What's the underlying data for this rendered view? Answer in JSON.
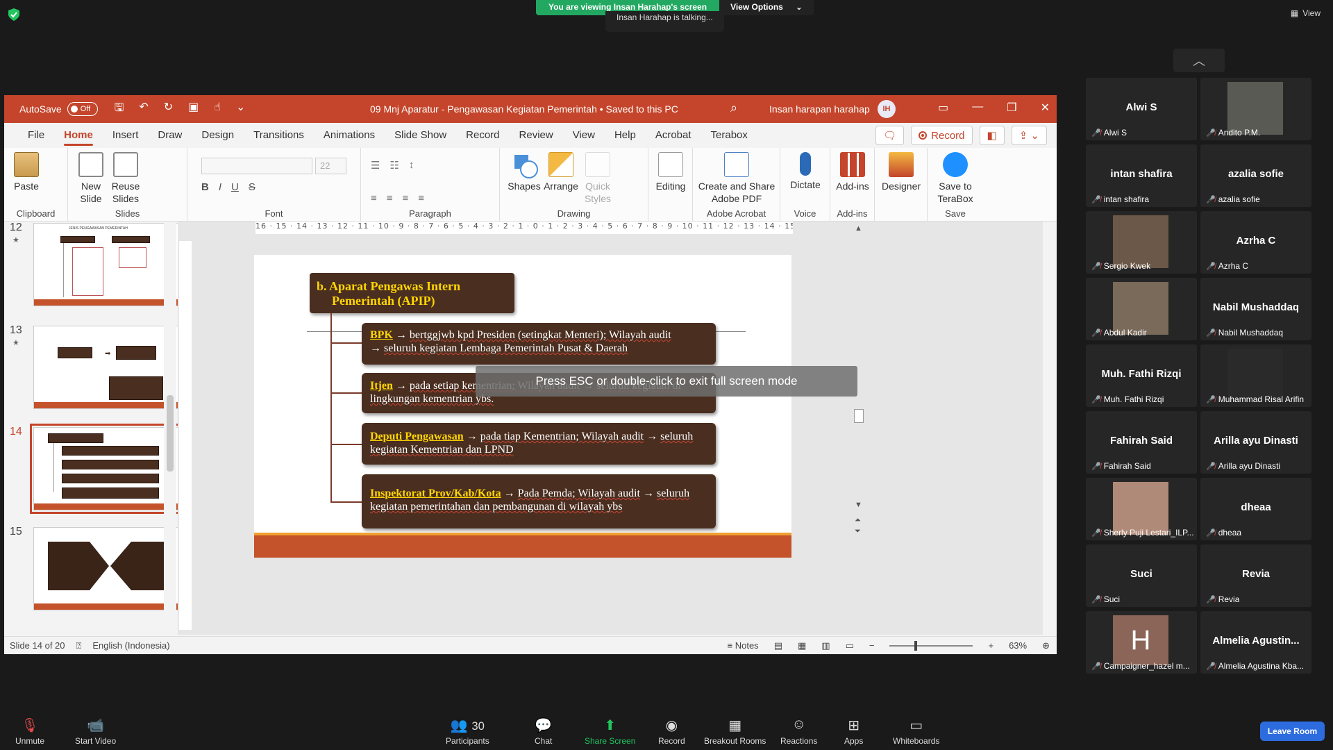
{
  "zoom": {
    "share_banner": "You are viewing Insan Harahap's screen",
    "view_options": "View Options",
    "talking": "Insan Harahap is talking...",
    "view_label": "View",
    "toolbar": {
      "unmute": "Unmute",
      "start_video": "Start Video",
      "participants": "Participants",
      "participants_count": "30",
      "chat": "Chat",
      "share_screen": "Share Screen",
      "record": "Record",
      "breakout": "Breakout Rooms",
      "reactions": "Reactions",
      "apps": "Apps",
      "whiteboards": "Whiteboards",
      "leave": "Leave Room"
    },
    "participants": [
      {
        "display": "Alwi S",
        "label": "Alwi S",
        "video": false
      },
      {
        "display": "",
        "label": "Andito P.M.",
        "video": true
      },
      {
        "display": "intan shafira",
        "label": "intan shafira",
        "video": false
      },
      {
        "display": "azalia sofie",
        "label": "azalia sofie",
        "video": false
      },
      {
        "display": "",
        "label": "Sergio Kwek",
        "video": true
      },
      {
        "display": "Azrha C",
        "label": "Azrha C",
        "video": false
      },
      {
        "display": "",
        "label": "Abdul Kadir",
        "video": true
      },
      {
        "display": "Nabil Mushaddaq",
        "label": "Nabil Mushaddaq",
        "video": false
      },
      {
        "display": "Muh. Fathi Rizqi",
        "label": "Muh. Fathi Rizqi",
        "video": false
      },
      {
        "display": "",
        "label": "Muhammad Risal Arifin",
        "video": true
      },
      {
        "display": "Fahirah Said",
        "label": "Fahirah Said",
        "video": false
      },
      {
        "display": "Arilla ayu Dinasti",
        "label": "Arilla ayu Dinasti",
        "video": false
      },
      {
        "display": "",
        "label": "Sherly Puji Lestari_ILP...",
        "video": true
      },
      {
        "display": "dheaa",
        "label": "dheaa",
        "video": false
      },
      {
        "display": "Suci",
        "label": "Suci",
        "video": false
      },
      {
        "display": "Revia",
        "label": "Revia",
        "video": false
      },
      {
        "display": "H",
        "label": "Campaigner_hazel m...",
        "video": false
      },
      {
        "display": "Almelia  Agustin...",
        "label": "Almelia Agustina Kba...",
        "video": false
      }
    ]
  },
  "ppt": {
    "autosave": "AutoSave",
    "autosave_state": "Off",
    "doc_title": "09  Mnj Aparatur - Pengawasan Kegiatan Pemerintah • Saved to this PC",
    "user_name": "Insan harapan harahap",
    "user_initials": "IH",
    "tabs": [
      "File",
      "Home",
      "Insert",
      "Draw",
      "Design",
      "Transitions",
      "Animations",
      "Slide Show",
      "Record",
      "Review",
      "View",
      "Help",
      "Acrobat",
      "Terabox"
    ],
    "active_tab": "Home",
    "record_button": "Record",
    "ribbon": {
      "paste": "Paste",
      "new_slide": "New Slide",
      "reuse_slides": "Reuse Slides",
      "font_size": "22",
      "shapes": "Shapes",
      "arrange": "Arrange",
      "quick_styles": "Quick Styles",
      "editing": "Editing",
      "create_share": "Create and Share Adobe PDF",
      "dictate": "Dictate",
      "addins": "Add-ins",
      "designer": "Designer",
      "save_terabox": "Save to TeraBox",
      "groups": {
        "clipboard": "Clipboard",
        "slides": "Slides",
        "font": "Font",
        "paragraph": "Paragraph",
        "drawing": "Drawing",
        "adobe": "Adobe Acrobat",
        "voice": "Voice",
        "addins": "Add-ins",
        "save": "Save"
      }
    },
    "ruler": "16 · 15 · 14 · 13 · 12 · 11 · 10 · 9 · 8 · 7 · 6 · 5 · 4 · 3 · 2 · 1 · 0 · 1 · 2 · 3 · 4 · 5 · 6 · 7 · 8 · 9 · 10 · 11 · 12 · 13 · 14 · 15 · 16",
    "thumbnails": [
      {
        "num": "12",
        "title": "JENIS PENGAWASAN PEMERINTAH"
      },
      {
        "num": "13"
      },
      {
        "num": "14"
      },
      {
        "num": "15"
      }
    ],
    "slide": {
      "title_line1": "b. Aparat Pengawas Intern",
      "title_line2": "Pemerintah (APIP)",
      "items": [
        {
          "kw": "BPK",
          "text": "bertggjwb kpd Presiden (setingkat Menteri); Wilayah audit",
          "text2": "seluruh kegiatan Lembaga Pemerintah Pusat & Daerah"
        },
        {
          "kw": "Itjen",
          "text": "pada setiap kementrian; Wilayah audit",
          "text2": "seluruh kegiatan di lingkungan kementrian ybs."
        },
        {
          "kw": "Deputi Pengawasan",
          "text": "pada tiap Kementrian; Wilayah audit",
          "text2": "seluruh kegiatan Kementrian dan LPND"
        },
        {
          "kw": "Inspektorat Prov/Kab/Kota",
          "text": "Pada Pemda; Wilayah audit",
          "text2": "seluruh kegiatan pemerintahan dan pembangunan di wilayah ybs"
        }
      ]
    },
    "esc_banner": "Press ESC or double-click to exit full screen mode",
    "status": {
      "slide_info": "Slide 14 of 20",
      "language": "English (Indonesia)",
      "notes": "Notes",
      "zoom": "63%"
    }
  }
}
